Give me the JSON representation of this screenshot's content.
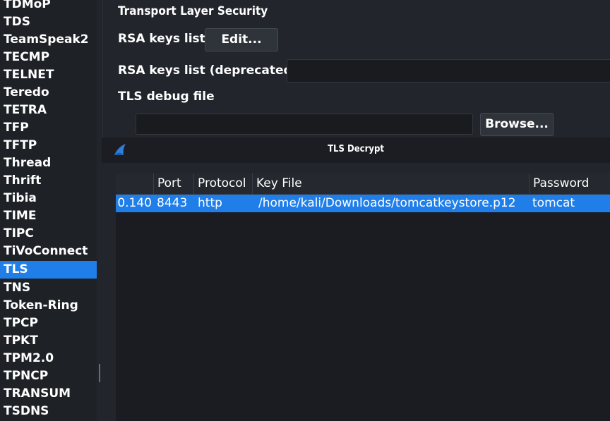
{
  "sidebar": {
    "items": [
      "TDMoP",
      "TDS",
      "TeamSpeak2",
      "TECMP",
      "TELNET",
      "Teredo",
      "TETRA",
      "TFP",
      "TFTP",
      "Thread",
      "Thrift",
      "Tibia",
      "TIME",
      "TIPC",
      "TiVoConnect",
      "TLS",
      "TNS",
      "Token-Ring",
      "TPCP",
      "TPKT",
      "TPM2.0",
      "TPNCP",
      "TRANSUM",
      "TSDNS"
    ],
    "selected": "TLS"
  },
  "prefs": {
    "section_title": "Transport Layer Security",
    "rsa_keys_label": "RSA keys list",
    "edit_button": "Edit...",
    "rsa_keys_deprecated_label": "RSA keys list (deprecated)",
    "rsa_keys_deprecated_value": "",
    "debug_file_label": "TLS debug file",
    "debug_file_value": "",
    "browse_button": "Browse..."
  },
  "dialog": {
    "title": "TLS Decrypt",
    "icon": "wireshark-fin-icon",
    "columns": [
      "",
      "Port",
      "Protocol",
      "Key File",
      "Password"
    ],
    "rows": [
      [
        "0.140",
        "8443",
        "http",
        "/home/kali/Downloads/tomcatkeystore.p12",
        "tomcat"
      ]
    ]
  },
  "colors": {
    "selection": "#1f7ee8",
    "background": "#22252b",
    "wireshark_blue": "#2f7fd8"
  }
}
